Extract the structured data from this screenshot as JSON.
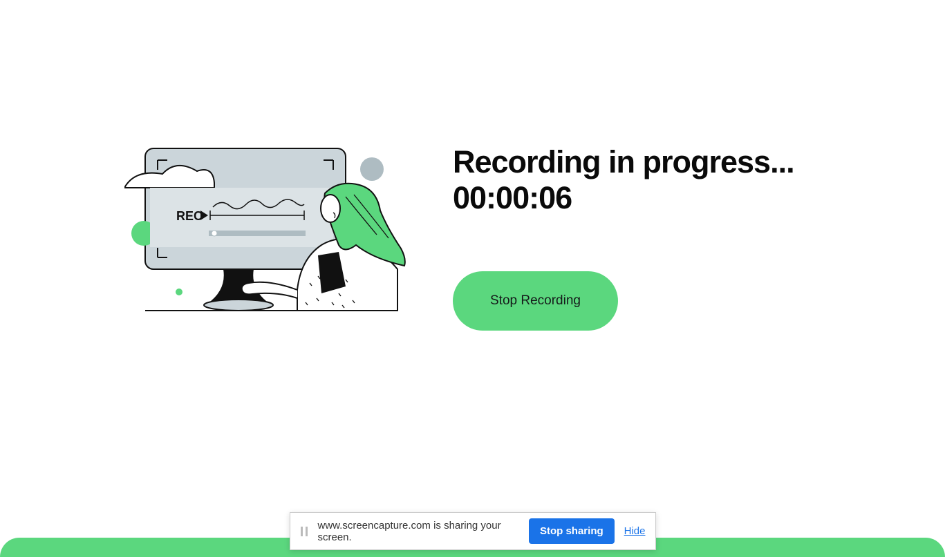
{
  "recording": {
    "title": "Recording in progress...",
    "timer": "00:00:06",
    "stop_label": "Stop Recording"
  },
  "share_bar": {
    "message": "www.screencapture.com is sharing your screen.",
    "stop_label": "Stop sharing",
    "hide_label": "Hide"
  },
  "illustration": {
    "rec_label": "REC"
  },
  "colors": {
    "accent_green": "#5bd77e",
    "blue": "#1a73e8"
  }
}
